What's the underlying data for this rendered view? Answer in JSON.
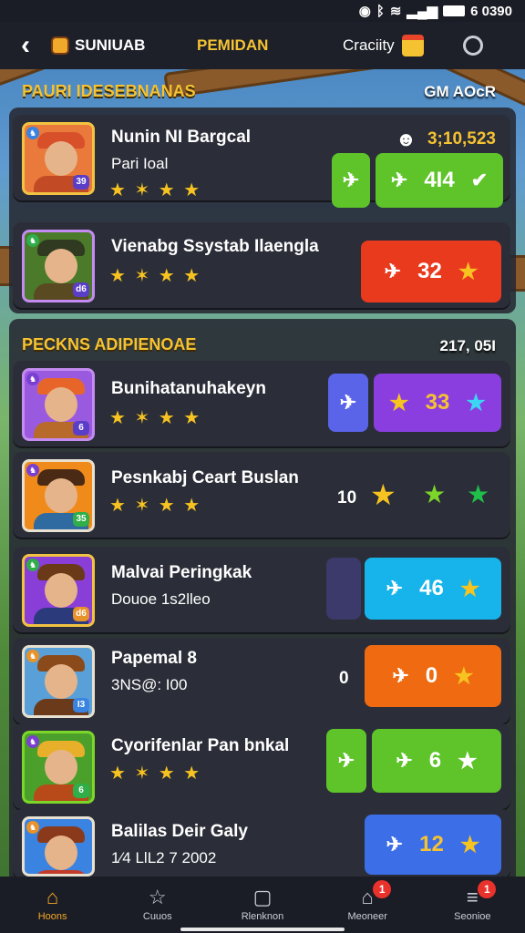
{
  "status": {
    "time": "6 0390"
  },
  "header": {
    "app_name": "SUNIUAB",
    "tab": "PEMIDAN",
    "capacity_label": "Craciity"
  },
  "section1": {
    "title": "PAURI IDESEBNANAS",
    "right": "GM AOcR",
    "rows": [
      {
        "name": "Nunin NI Bargcal",
        "sub": "Pari Ioal",
        "stars": "★ ✶ ★ ★",
        "badge": "39",
        "score": "3;10,523",
        "btn_value": "4I4",
        "colors": {
          "avatar_bg": "#e97a3b",
          "border": "#f2c342"
        }
      },
      {
        "name": "Vienabg Ssystab Ilaengla",
        "stars": "★ ✶ ★ ★",
        "badge": "d6",
        "btn_value": "32",
        "colors": {
          "avatar_bg": "#4a7a2a",
          "border": "#c48bf2"
        }
      }
    ]
  },
  "section2": {
    "title": "PECKNS ADIPIENOAE",
    "right": "217, 05I",
    "rows": [
      {
        "name": "Bunihatanuhakeyn",
        "stars": "★ ✶ ★ ★",
        "badge": "6",
        "btn_value": "33"
      },
      {
        "name": "Pesnkabj Ceart Buslan",
        "stars": "★ ✶ ★ ★",
        "badge": "35",
        "plain_value": "10"
      },
      {
        "name": "Malvai Peringkak",
        "sub": "Douoe 1s2lleo",
        "badge": "d6",
        "btn_value": "46"
      },
      {
        "name": "Papemal 8",
        "sub": "3NS@: I00",
        "badge": "I3",
        "plain_value": "0",
        "btn_value": "0"
      },
      {
        "name": "Cyorifenlar Pan bnkal",
        "stars": "★ ✶ ★ ★",
        "badge": "6",
        "btn_value": "6"
      },
      {
        "name": "Balilas Deir Galy",
        "sub": "1⁄4 LlL2 7 2002",
        "badge": "",
        "btn_value": "12"
      }
    ]
  },
  "nav": {
    "items": [
      {
        "label": "Hoons",
        "icon": "home-icon"
      },
      {
        "label": "Cuuos",
        "icon": "star-outline-icon"
      },
      {
        "label": "Rlenknon",
        "icon": "square-icon"
      },
      {
        "label": "Meoneer",
        "icon": "house-icon",
        "badge": "1"
      },
      {
        "label": "Seonioe",
        "icon": "menu-icon",
        "badge": "1"
      }
    ]
  },
  "colors": {
    "accent": "#f5c232",
    "green": "#5ec42a",
    "red": "#ea3a1e",
    "purple": "#8a3ee0",
    "cyan": "#16b4ea",
    "orange": "#ef6a10",
    "blue": "#3c6ee8"
  }
}
